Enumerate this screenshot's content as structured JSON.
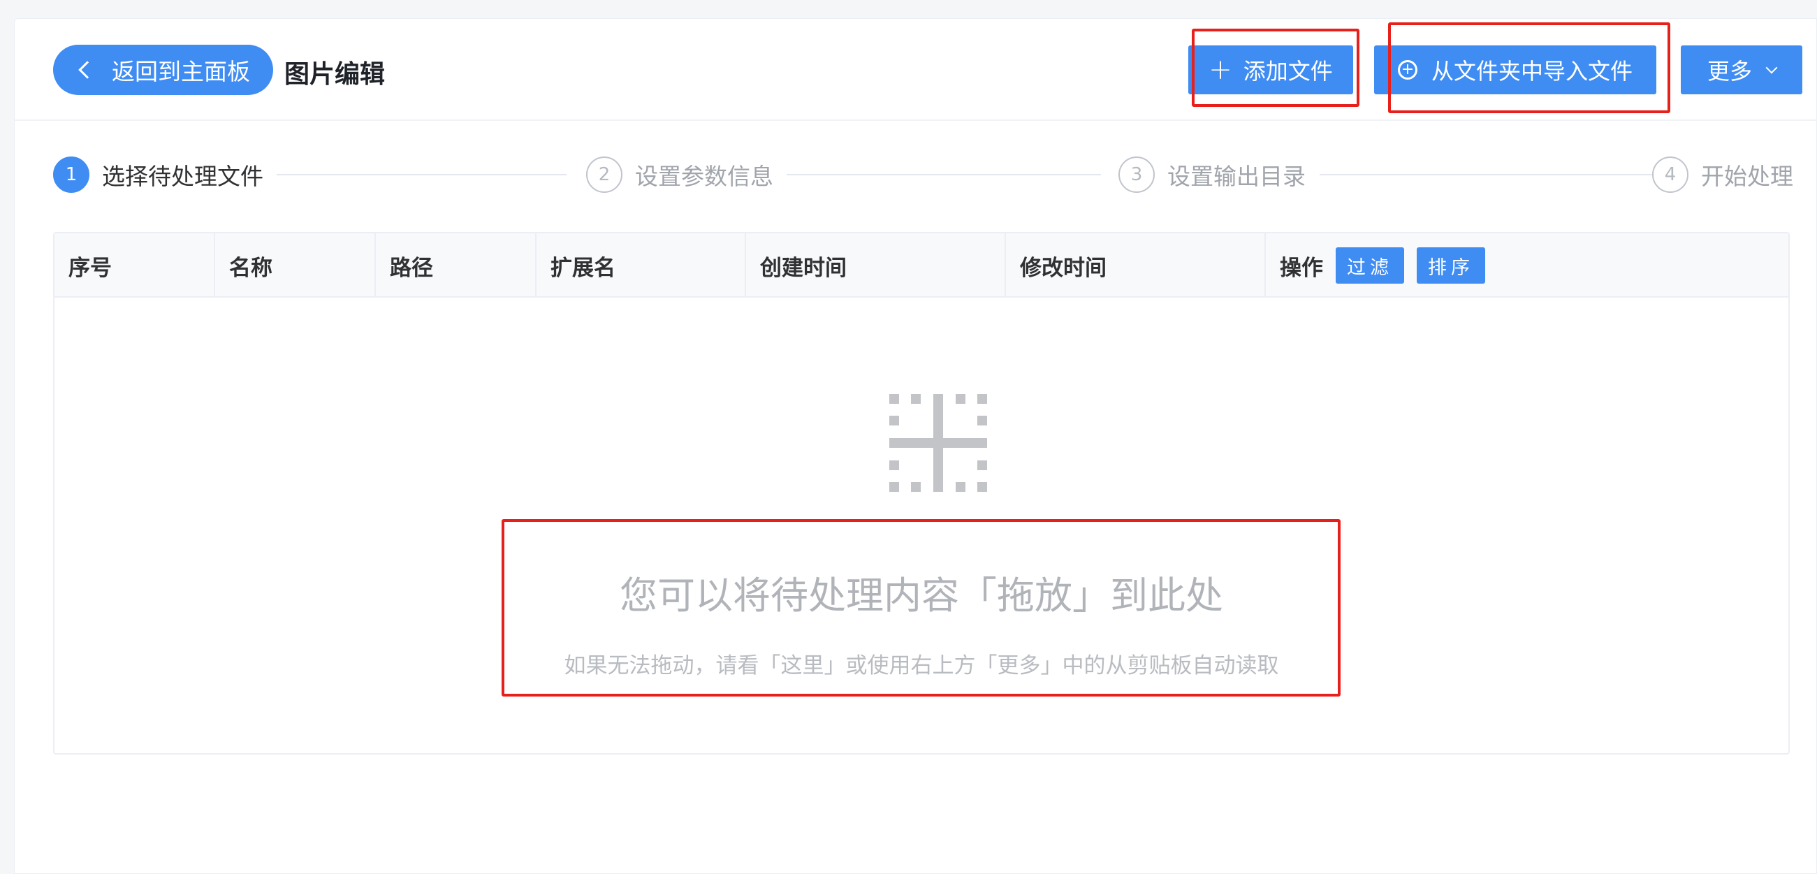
{
  "header": {
    "back_label": "返回到主面板",
    "title": "图片编辑",
    "add_file_label": "添加文件",
    "import_folder_label": "从文件夹中导入文件",
    "more_label": "更多"
  },
  "steps": [
    {
      "num": "1",
      "label": "选择待处理文件",
      "active": true
    },
    {
      "num": "2",
      "label": "设置参数信息",
      "active": false
    },
    {
      "num": "3",
      "label": "设置输出目录",
      "active": false
    },
    {
      "num": "4",
      "label": "开始处理",
      "active": false
    }
  ],
  "table": {
    "columns": [
      "序号",
      "名称",
      "路径",
      "扩展名",
      "创建时间",
      "修改时间",
      "操作"
    ],
    "filter_label": "过滤",
    "sort_label": "排序",
    "empty_title": "您可以将待处理内容「拖放」到此处",
    "empty_hint": "如果无法拖动，请看「这里」或使用右上方「更多」中的从剪贴板自动读取"
  },
  "colors": {
    "primary": "#3f8cf2",
    "highlight_box": "#e8201c"
  },
  "icons": {
    "back": "chevron-left-icon",
    "add": "plus-icon",
    "import": "circle-plus-icon",
    "more": "chevron-down-icon",
    "empty": "drop-target-icon"
  }
}
